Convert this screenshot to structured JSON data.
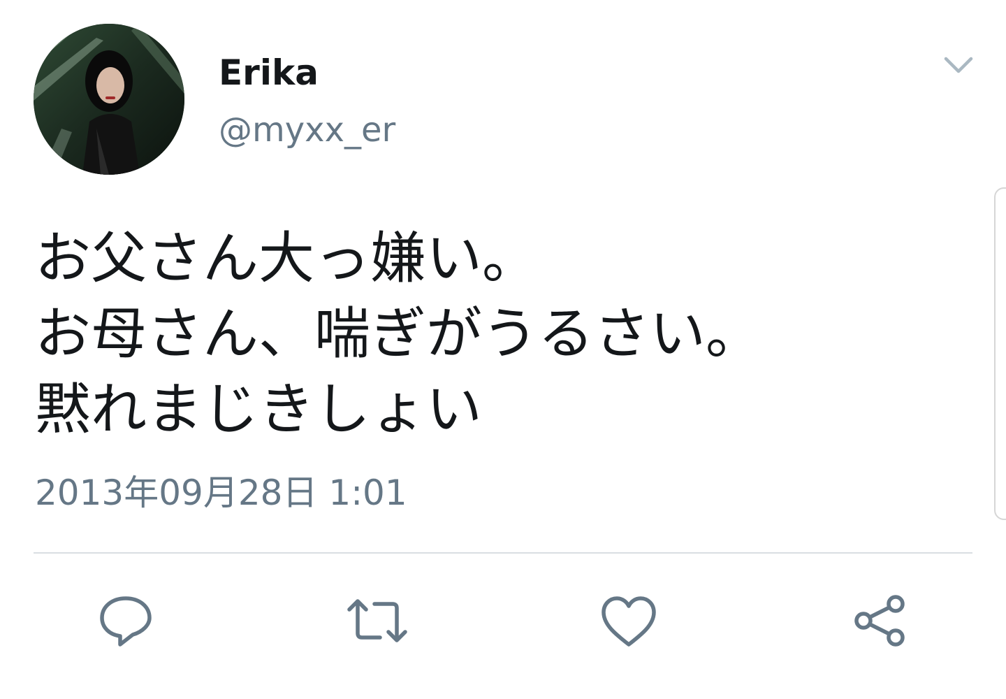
{
  "tweet": {
    "author": {
      "display_name": "Erika",
      "handle": "@myxx_er"
    },
    "text_lines": [
      "お父さん大っ嫌い。",
      "お母さん、喘ぎがうるさい。",
      "黙れまじきしょい"
    ],
    "timestamp": "2013年09月28日 1:01"
  },
  "actions": [
    {
      "name": "reply",
      "icon": "reply-icon"
    },
    {
      "name": "retweet",
      "icon": "retweet-icon"
    },
    {
      "name": "like",
      "icon": "heart-icon"
    },
    {
      "name": "share",
      "icon": "share-icon"
    }
  ],
  "menu": {
    "icon": "chevron-down-icon"
  },
  "colors": {
    "text_primary": "#14171a",
    "text_secondary": "#657786",
    "icon_gray": "#657786",
    "divider": "#d9dee2",
    "background": "#ffffff"
  }
}
